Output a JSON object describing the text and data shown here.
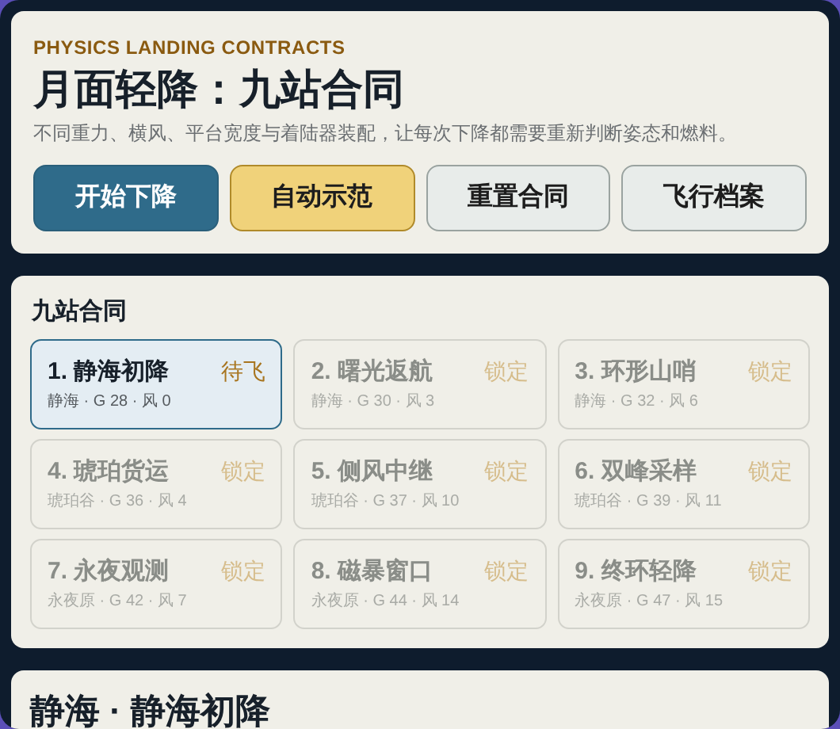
{
  "header": {
    "eyebrow": "PHYSICS LANDING CONTRACTS",
    "title": "月面轻降：九站合同",
    "subtitle": "不同重力、横风、平台宽度与着陆器装配，让每次下降都需要重新判断姿态和燃料。"
  },
  "buttons": [
    {
      "label": "开始下降",
      "kind": "primary"
    },
    {
      "label": "自动示范",
      "kind": "accent"
    },
    {
      "label": "重置合同",
      "kind": "plain"
    },
    {
      "label": "飞行档案",
      "kind": "plain"
    }
  ],
  "stations": {
    "title": "九站合同",
    "items": [
      {
        "name": "1. 静海初降",
        "status": "待飞",
        "info": "静海 · G 28 · 风 0",
        "selected": true,
        "locked": false
      },
      {
        "name": "2. 曙光返航",
        "status": "锁定",
        "info": "静海 · G 30 · 风 3",
        "selected": false,
        "locked": true
      },
      {
        "name": "3. 环形山哨",
        "status": "锁定",
        "info": "静海 · G 32 · 风 6",
        "selected": false,
        "locked": true
      },
      {
        "name": "4. 琥珀货运",
        "status": "锁定",
        "info": "琥珀谷 · G 36 · 风 4",
        "selected": false,
        "locked": true
      },
      {
        "name": "5. 侧风中继",
        "status": "锁定",
        "info": "琥珀谷 · G 37 · 风 10",
        "selected": false,
        "locked": true
      },
      {
        "name": "6. 双峰采样",
        "status": "锁定",
        "info": "琥珀谷 · G 39 · 风 11",
        "selected": false,
        "locked": true
      },
      {
        "name": "7. 永夜观测",
        "status": "锁定",
        "info": "永夜原 · G 42 · 风 7",
        "selected": false,
        "locked": true
      },
      {
        "name": "8. 磁暴窗口",
        "status": "锁定",
        "info": "永夜原 · G 44 · 风 14",
        "selected": false,
        "locked": true
      },
      {
        "name": "9. 终环轻降",
        "status": "锁定",
        "info": "永夜原 · G 47 · 风 15",
        "selected": false,
        "locked": true
      }
    ]
  },
  "detail": {
    "title": "静海 · 静海初降"
  }
}
